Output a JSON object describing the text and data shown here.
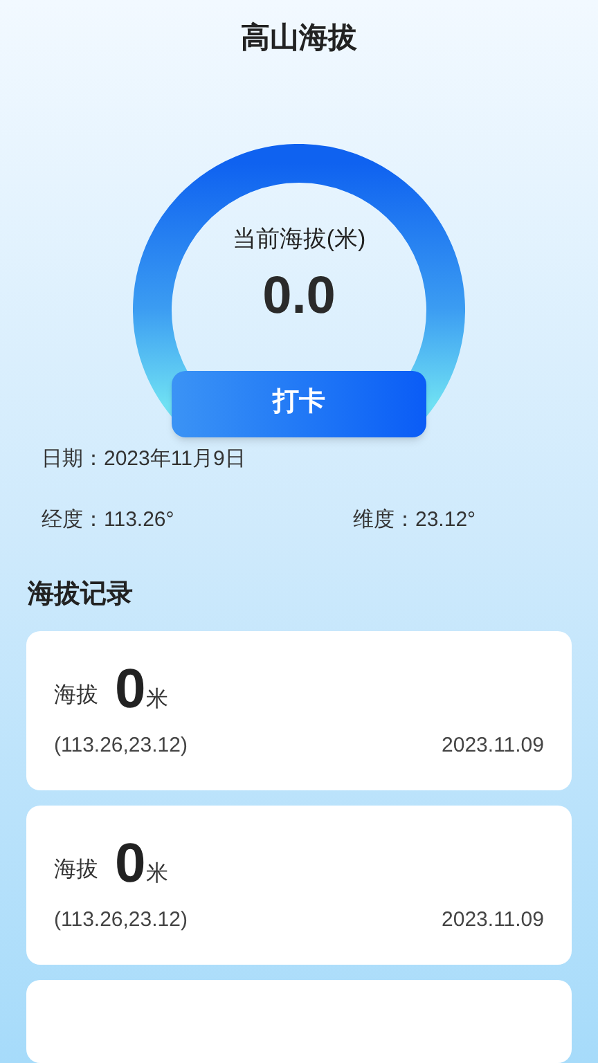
{
  "header": {
    "title": "高山海拔"
  },
  "gauge": {
    "label": "当前海拔(米)",
    "value": "0.0",
    "button": "打卡"
  },
  "info": {
    "date": "日期：2023年11月9日",
    "longitude": "经度：113.26°",
    "latitude": "维度：23.12°"
  },
  "records": {
    "title": "海拔记录",
    "items": [
      {
        "kind": "full",
        "label": "海拔",
        "value": "0",
        "unit": "米",
        "coords": "(113.26,23.12)",
        "date": "2023.11.09"
      },
      {
        "kind": "full",
        "label": "海拔",
        "value": "0",
        "unit": "米",
        "coords": "(113.26,23.12)",
        "date": "2023.11.09"
      },
      {
        "kind": "cut"
      }
    ]
  }
}
